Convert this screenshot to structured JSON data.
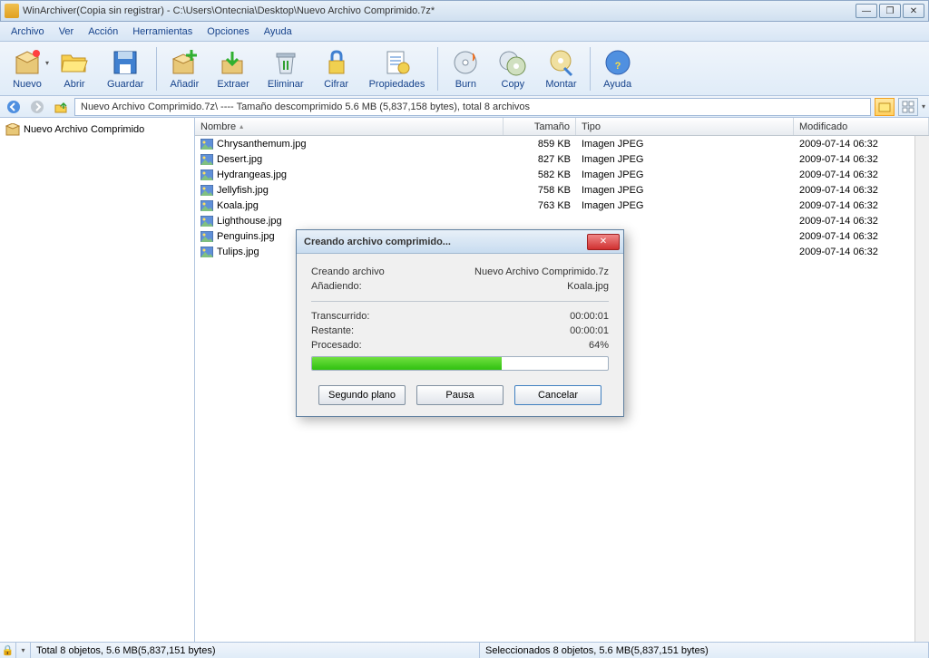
{
  "window": {
    "title": "WinArchiver(Copia sin registrar) - C:\\Users\\Ontecnia\\Desktop\\Nuevo Archivo Comprimido.7z*"
  },
  "menu": {
    "items": [
      "Archivo",
      "Ver",
      "Acción",
      "Herramientas",
      "Opciones",
      "Ayuda"
    ]
  },
  "toolbar": {
    "items": [
      {
        "label": "Nuevo",
        "icon": "box-new",
        "dropdown": true
      },
      {
        "label": "Abrir",
        "icon": "folder-open"
      },
      {
        "label": "Guardar",
        "icon": "floppy"
      },
      {
        "label": "Añadir",
        "icon": "box-add"
      },
      {
        "label": "Extraer",
        "icon": "box-extract"
      },
      {
        "label": "Eliminar",
        "icon": "recycle"
      },
      {
        "label": "Cifrar",
        "icon": "lock"
      },
      {
        "label": "Propiedades",
        "icon": "properties"
      },
      {
        "label": "Burn",
        "icon": "disc-burn"
      },
      {
        "label": "Copy",
        "icon": "disc-copy"
      },
      {
        "label": "Montar",
        "icon": "disc-mount"
      },
      {
        "label": "Ayuda",
        "icon": "help"
      }
    ]
  },
  "nav": {
    "path_text": "Nuevo Archivo Comprimido.7z\\    ----    Tamaño descomprimido 5.6 MB (5,837,158 bytes), total 8 archivos"
  },
  "sidebar": {
    "root": "Nuevo Archivo Comprimido"
  },
  "columns": {
    "name": "Nombre",
    "size": "Tamaño",
    "type": "Tipo",
    "modified": "Modificado"
  },
  "files": [
    {
      "name": "Chrysanthemum.jpg",
      "size": "859 KB",
      "type": "Imagen JPEG",
      "modified": "2009-07-14 06:32"
    },
    {
      "name": "Desert.jpg",
      "size": "827 KB",
      "type": "Imagen JPEG",
      "modified": "2009-07-14 06:32"
    },
    {
      "name": "Hydrangeas.jpg",
      "size": "582 KB",
      "type": "Imagen JPEG",
      "modified": "2009-07-14 06:32"
    },
    {
      "name": "Jellyfish.jpg",
      "size": "758 KB",
      "type": "Imagen JPEG",
      "modified": "2009-07-14 06:32"
    },
    {
      "name": "Koala.jpg",
      "size": "763 KB",
      "type": "Imagen JPEG",
      "modified": "2009-07-14 06:32"
    },
    {
      "name": "Lighthouse.jpg",
      "size": "",
      "type": "",
      "modified": "2009-07-14 06:32"
    },
    {
      "name": "Penguins.jpg",
      "size": "",
      "type": "",
      "modified": "2009-07-14 06:32"
    },
    {
      "name": "Tulips.jpg",
      "size": "",
      "type": "",
      "modified": "2009-07-14 06:32"
    }
  ],
  "dialog": {
    "title": "Creando archivo comprimido...",
    "creating_label": "Creando archivo",
    "creating_value": "Nuevo Archivo Comprimido.7z",
    "adding_label": "Añadiendo:",
    "adding_value": "Koala.jpg",
    "elapsed_label": "Transcurrido:",
    "elapsed_value": "00:00:01",
    "remaining_label": "Restante:",
    "remaining_value": "00:00:01",
    "processed_label": "Procesado:",
    "processed_value": "64%",
    "progress_percent": 64,
    "btn_background": "Segundo plano",
    "btn_pause": "Pausa",
    "btn_cancel": "Cancelar"
  },
  "statusbar": {
    "total": "Total 8 objetos,  5.6 MB(5,837,151 bytes)",
    "selected": "Seleccionados 8 objetos,  5.6 MB(5,837,151 bytes)"
  }
}
